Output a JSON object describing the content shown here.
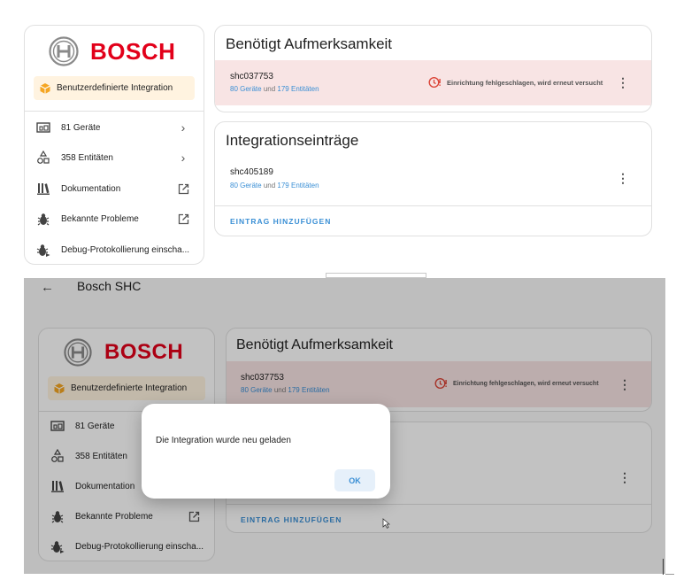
{
  "brand": {
    "name": "BOSCH",
    "integration_badge": "Benutzerdefinierte Integration"
  },
  "sidebar": {
    "items": [
      {
        "icon": "device-icon",
        "label": "81 Geräte",
        "trail": "chevron-right-icon"
      },
      {
        "icon": "entities-icon",
        "label": "358 Entitäten",
        "trail": "chevron-right-icon"
      },
      {
        "icon": "book-icon",
        "label": "Dokumentation",
        "trail": "open-in-new-icon"
      },
      {
        "icon": "bug-icon",
        "label": "Bekannte Probleme",
        "trail": "open-in-new-icon"
      },
      {
        "icon": "bug-play-icon",
        "label": "Debug-Protokollierung einscha...",
        "trail": ""
      }
    ]
  },
  "attention": {
    "title": "Benötigt Aufmerksamkeit",
    "entry": {
      "name": "shc037753",
      "devices": "80 Geräte",
      "conjunction": "und",
      "entities": "179 Entitäten",
      "error": "Einrichtung fehlgeschlagen, wird erneut versucht"
    }
  },
  "entries": {
    "title": "Integrationseinträge",
    "entry": {
      "name": "shc405189",
      "devices": "80 Geräte",
      "conjunction": "und",
      "entities": "179 Entitäten"
    },
    "add_button": "EINTRAG HINZUFÜGEN"
  },
  "topbar": {
    "back_icon": "arrow-left-icon",
    "title": "Bosch SHC"
  },
  "dialog": {
    "message": "Die Integration wurde neu geladen",
    "ok_label": "OK"
  },
  "colors": {
    "brand_red": "#e2001a",
    "accent": "#3a8fd5",
    "error_bg": "#f8e4e4",
    "error_icon": "#db4437",
    "badge_bg": "#fff3e0"
  }
}
